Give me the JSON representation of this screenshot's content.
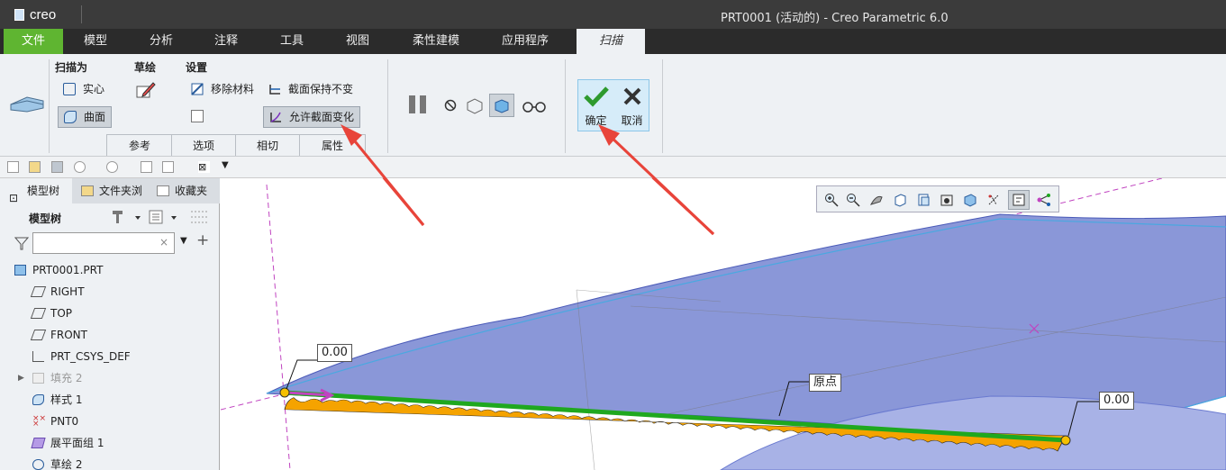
{
  "app": {
    "logo": "creo",
    "window_title": "PRT0001 (活动的) - Creo Parametric 6.0"
  },
  "menus": [
    {
      "id": "file",
      "label": "文件"
    },
    {
      "id": "model",
      "label": "模型"
    },
    {
      "id": "analysis",
      "label": "分析"
    },
    {
      "id": "annotate",
      "label": "注释"
    },
    {
      "id": "tools",
      "label": "工具"
    },
    {
      "id": "view",
      "label": "视图"
    },
    {
      "id": "flexible",
      "label": "柔性建模"
    },
    {
      "id": "apps",
      "label": "应用程序"
    },
    {
      "id": "sweep",
      "label": "扫描"
    }
  ],
  "ribbon": {
    "sweep_as": "扫描为",
    "solid": "实心",
    "surface": "曲面",
    "sketch": "草绘",
    "settings": "设置",
    "remove_material": "移除材料",
    "section_constant": "截面保持不变",
    "allow_section_change": "允许截面变化",
    "ok": "确定",
    "cancel": "取消",
    "panel_tabs": [
      "参考",
      "选项",
      "相切",
      "属性"
    ]
  },
  "left_panel": {
    "tabs": [
      "模型树",
      "文件夹浏",
      "收藏夹"
    ],
    "tree_header": "模型树",
    "search_placeholder": "",
    "items": [
      {
        "label": "PRT0001.PRT",
        "icon": "part-icon"
      },
      {
        "label": "RIGHT",
        "icon": "datum-plane-icon"
      },
      {
        "label": "TOP",
        "icon": "datum-plane-icon"
      },
      {
        "label": "FRONT",
        "icon": "datum-plane-icon"
      },
      {
        "label": "PRT_CSYS_DEF",
        "icon": "csys-icon"
      },
      {
        "label": "填充 2",
        "icon": "fill-icon"
      },
      {
        "label": "样式 1",
        "icon": "style-icon"
      },
      {
        "label": "PNT0",
        "icon": "datum-point-icon"
      },
      {
        "label": "展平面组 1",
        "icon": "flatten-quilt-icon"
      },
      {
        "label": "草绘 2",
        "icon": "sketch-icon"
      }
    ]
  },
  "viewport": {
    "dim_left": "0.00",
    "dim_right": "0.00",
    "origin_label": "原点"
  },
  "colors": {
    "surface": "#8a97d8",
    "sweep": "#f5a300",
    "trajectory": "#1fa81f",
    "arrow": "#e8443a",
    "file_menu": "#5fb531"
  }
}
